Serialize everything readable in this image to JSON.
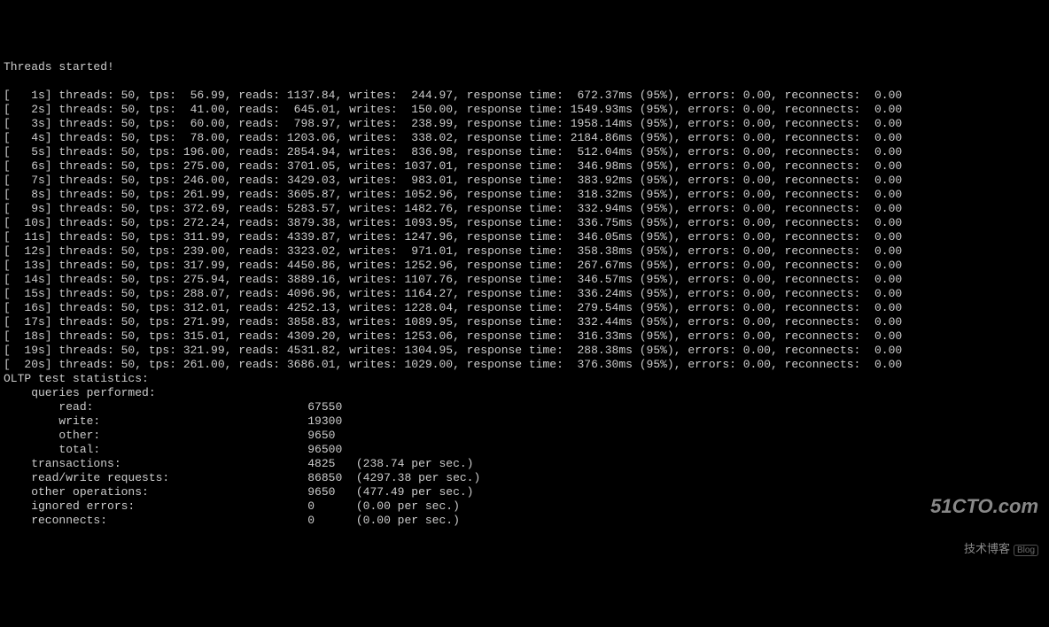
{
  "header": "Threads started!",
  "rows": [
    {
      "t": "1s",
      "threads": "50",
      "tps": "56.99",
      "reads": "1137.84",
      "writes": "244.97",
      "rt": "672.37ms",
      "pctl": "95%",
      "err": "0.00",
      "rec": "0.00"
    },
    {
      "t": "2s",
      "threads": "50",
      "tps": "41.00",
      "reads": "645.01",
      "writes": "150.00",
      "rt": "1549.93ms",
      "pctl": "95%",
      "err": "0.00",
      "rec": "0.00"
    },
    {
      "t": "3s",
      "threads": "50",
      "tps": "60.00",
      "reads": "798.97",
      "writes": "238.99",
      "rt": "1958.14ms",
      "pctl": "95%",
      "err": "0.00",
      "rec": "0.00"
    },
    {
      "t": "4s",
      "threads": "50",
      "tps": "78.00",
      "reads": "1203.06",
      "writes": "338.02",
      "rt": "2184.86ms",
      "pctl": "95%",
      "err": "0.00",
      "rec": "0.00"
    },
    {
      "t": "5s",
      "threads": "50",
      "tps": "196.00",
      "reads": "2854.94",
      "writes": "836.98",
      "rt": "512.04ms",
      "pctl": "95%",
      "err": "0.00",
      "rec": "0.00"
    },
    {
      "t": "6s",
      "threads": "50",
      "tps": "275.00",
      "reads": "3701.05",
      "writes": "1037.01",
      "rt": "346.98ms",
      "pctl": "95%",
      "err": "0.00",
      "rec": "0.00"
    },
    {
      "t": "7s",
      "threads": "50",
      "tps": "246.00",
      "reads": "3429.03",
      "writes": "983.01",
      "rt": "383.92ms",
      "pctl": "95%",
      "err": "0.00",
      "rec": "0.00"
    },
    {
      "t": "8s",
      "threads": "50",
      "tps": "261.99",
      "reads": "3605.87",
      "writes": "1052.96",
      "rt": "318.32ms",
      "pctl": "95%",
      "err": "0.00",
      "rec": "0.00"
    },
    {
      "t": "9s",
      "threads": "50",
      "tps": "372.69",
      "reads": "5283.57",
      "writes": "1482.76",
      "rt": "332.94ms",
      "pctl": "95%",
      "err": "0.00",
      "rec": "0.00"
    },
    {
      "t": "10s",
      "threads": "50",
      "tps": "272.24",
      "reads": "3879.38",
      "writes": "1093.95",
      "rt": "336.75ms",
      "pctl": "95%",
      "err": "0.00",
      "rec": "0.00"
    },
    {
      "t": "11s",
      "threads": "50",
      "tps": "311.99",
      "reads": "4339.87",
      "writes": "1247.96",
      "rt": "346.05ms",
      "pctl": "95%",
      "err": "0.00",
      "rec": "0.00"
    },
    {
      "t": "12s",
      "threads": "50",
      "tps": "239.00",
      "reads": "3323.02",
      "writes": "971.01",
      "rt": "358.38ms",
      "pctl": "95%",
      "err": "0.00",
      "rec": "0.00"
    },
    {
      "t": "13s",
      "threads": "50",
      "tps": "317.99",
      "reads": "4450.86",
      "writes": "1252.96",
      "rt": "267.67ms",
      "pctl": "95%",
      "err": "0.00",
      "rec": "0.00"
    },
    {
      "t": "14s",
      "threads": "50",
      "tps": "275.94",
      "reads": "3889.16",
      "writes": "1107.76",
      "rt": "346.57ms",
      "pctl": "95%",
      "err": "0.00",
      "rec": "0.00"
    },
    {
      "t": "15s",
      "threads": "50",
      "tps": "288.07",
      "reads": "4096.96",
      "writes": "1164.27",
      "rt": "336.24ms",
      "pctl": "95%",
      "err": "0.00",
      "rec": "0.00"
    },
    {
      "t": "16s",
      "threads": "50",
      "tps": "312.01",
      "reads": "4252.13",
      "writes": "1228.04",
      "rt": "279.54ms",
      "pctl": "95%",
      "err": "0.00",
      "rec": "0.00"
    },
    {
      "t": "17s",
      "threads": "50",
      "tps": "271.99",
      "reads": "3858.83",
      "writes": "1089.95",
      "rt": "332.44ms",
      "pctl": "95%",
      "err": "0.00",
      "rec": "0.00"
    },
    {
      "t": "18s",
      "threads": "50",
      "tps": "315.01",
      "reads": "4309.20",
      "writes": "1253.06",
      "rt": "316.33ms",
      "pctl": "95%",
      "err": "0.00",
      "rec": "0.00"
    },
    {
      "t": "19s",
      "threads": "50",
      "tps": "321.99",
      "reads": "4531.82",
      "writes": "1304.95",
      "rt": "288.38ms",
      "pctl": "95%",
      "err": "0.00",
      "rec": "0.00"
    },
    {
      "t": "20s",
      "threads": "50",
      "tps": "261.00",
      "reads": "3686.01",
      "writes": "1029.00",
      "rt": "376.30ms",
      "pctl": "95%",
      "err": "0.00",
      "rec": "0.00"
    }
  ],
  "stats": {
    "title": "OLTP test statistics:",
    "queries_label": "queries performed:",
    "read_label": "read:",
    "read_val": "67550",
    "write_label": "write:",
    "write_val": "19300",
    "other_label": "other:",
    "other_val": "9650",
    "total_label": "total:",
    "total_val": "96500",
    "transactions_label": "transactions:",
    "transactions_val": "4825",
    "transactions_per": "(238.74 per sec.)",
    "rw_label": "read/write requests:",
    "rw_val": "86850",
    "rw_per": "(4297.38 per sec.)",
    "oo_label": "other operations:",
    "oo_val": "9650",
    "oo_per": "(477.49 per sec.)",
    "ie_label": "ignored errors:",
    "ie_val": "0",
    "ie_per": "(0.00 per sec.)",
    "re_label": "reconnects:",
    "re_val": "0",
    "re_per": "(0.00 per sec.)"
  },
  "watermark": {
    "host": "51CTO.com",
    "sub": "技术博客",
    "badge": "Blog"
  }
}
